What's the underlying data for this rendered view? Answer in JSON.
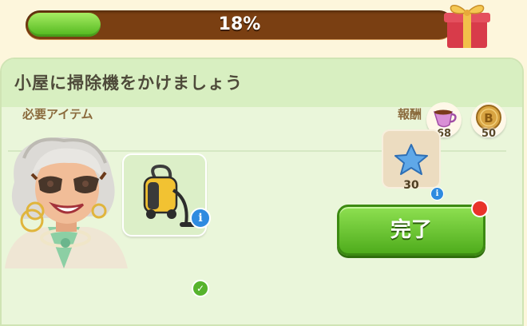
{
  "progress": {
    "percent_text": "18%",
    "value": 0.18
  },
  "panel": {
    "title": "小屋に掃除機をかけましょう"
  },
  "currency": {
    "cup": {
      "icon": "tea-cup-icon",
      "count": "68"
    },
    "coin": {
      "icon": "coin-icon",
      "count": "50"
    }
  },
  "requirements": {
    "label": "必要アイテム",
    "item": {
      "icon": "vacuum-cleaner-icon",
      "info": "i",
      "status": "✓"
    }
  },
  "reward": {
    "label": "報酬",
    "icon": "blue-star-icon",
    "count": "30",
    "info": "i"
  },
  "complete_button": {
    "label": "完了"
  },
  "colors": {
    "accent_green": "#4fb61c",
    "bar_brown": "#7a3f12",
    "info_blue": "#2f8be0",
    "alert_red": "#e8332a"
  }
}
